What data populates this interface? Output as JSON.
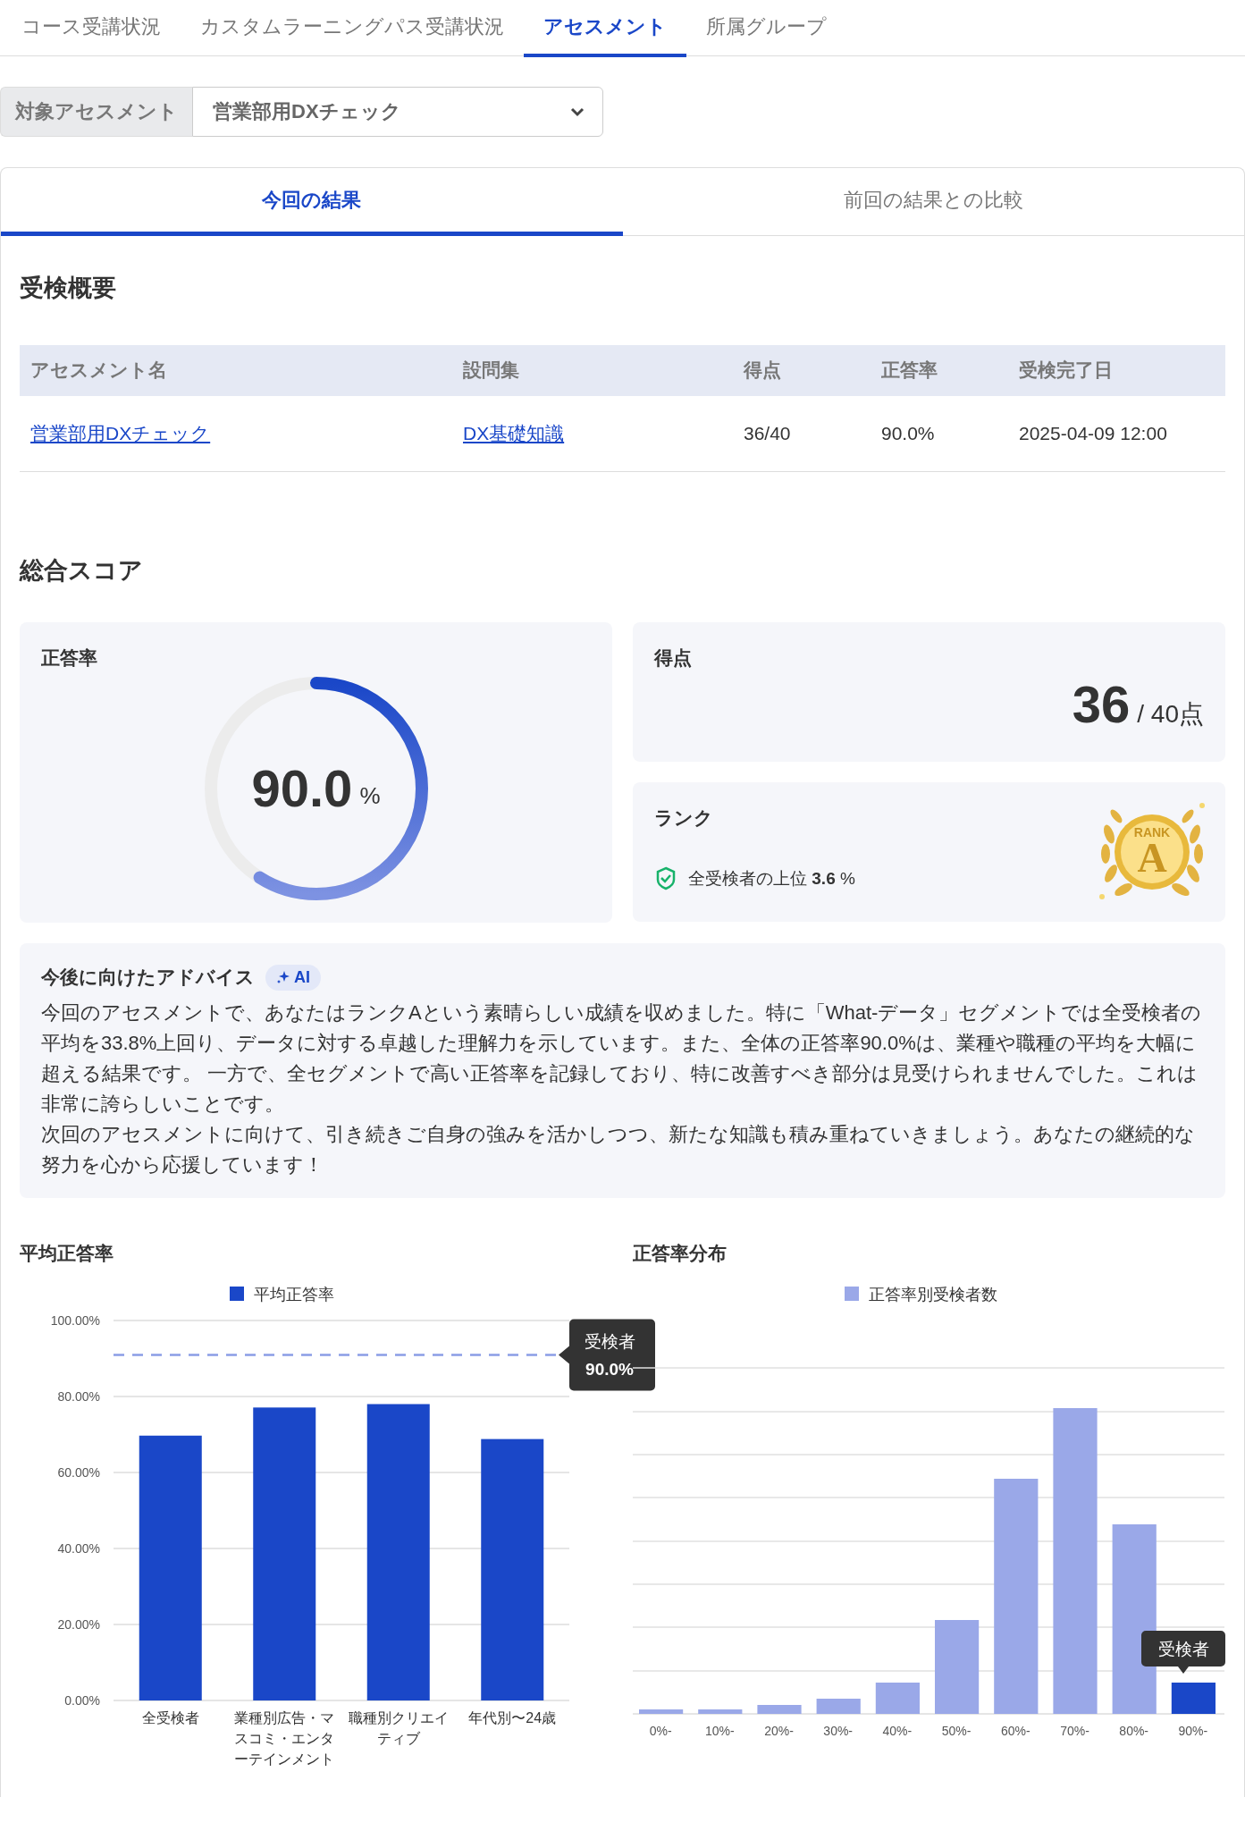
{
  "top_tabs": [
    {
      "label": "コース受講状況",
      "selected": false
    },
    {
      "label": "カスタムラーニングパス受講状況",
      "selected": false
    },
    {
      "label": "アセスメント",
      "selected": true
    },
    {
      "label": "所属グループ",
      "selected": false
    }
  ],
  "assessment_select": {
    "label": "対象アセスメント",
    "value": "営業部用DXチェック"
  },
  "result_tabs": [
    {
      "label": "今回の結果",
      "selected": true
    },
    {
      "label": "前回の結果との比較",
      "selected": false
    }
  ],
  "summary": {
    "title": "受検概要",
    "columns": [
      "アセスメント名",
      "設問集",
      "得点",
      "正答率",
      "受検完了日"
    ],
    "rows": [
      [
        {
          "text": "営業部用DXチェック",
          "kind": "link"
        },
        {
          "text": "DX基礎知識",
          "kind": "link"
        },
        {
          "text": "36/40",
          "kind": "text"
        },
        {
          "text": "90.0%",
          "kind": "text"
        },
        {
          "text": "2025-04-09 12:00",
          "kind": "text"
        }
      ]
    ]
  },
  "total_score": {
    "title": "総合スコア",
    "accuracy": {
      "label": "正答率",
      "value": "90.0",
      "unit": "%",
      "level": 0.59
    },
    "points": {
      "label": "得点",
      "value": "36",
      "max": "/ 40点"
    },
    "rank": {
      "label": "ランク",
      "percentile": "全受検者の上位 **3.6** %",
      "badge_label": "RANK",
      "grade": "A"
    }
  },
  "advice": {
    "title": "今後に向けたアドバイス",
    "badge": "AI",
    "paragraphs": [
      "今回のアセスメントで、あなたはランクAという素晴らしい成績を収めました。特に「What-データ」セグメントでは全受検者の平均を33.8%上回り、データに対する卓越した理解力を示しています。また、全体の正答率90.0%は、業種や職種の平均を大幅に超える結果です。 一方で、全セグメントで高い正答率を記録しており、特に改善すべき部分は見受けられませんでした。これは非常に誇らしいことです。",
      "次回のアセスメントに向けて、引き続きご自身の強みを活かしつつ、新たな知識も積み重ねていきましょう。あなたの継続的な努力を心から応援しています！"
    ]
  },
  "average_chart": {
    "title": "平均正答率",
    "chart_data": {
      "type": "bar",
      "categories": [
        "全受検者",
        "業種別広告・マスコミ・エンターテインメント",
        "職種別クリエイティブ",
        "年代別〜24歳"
      ],
      "series": [
        {
          "name": "平均正答率",
          "color": "#1a47c8",
          "values": [
            69.7,
            77.1,
            78.0,
            68.8
          ]
        }
      ],
      "ylim": [
        0,
        100
      ],
      "grid": true,
      "yticks": [
        {
          "value": 0,
          "label": "0.00%"
        },
        {
          "value": 20,
          "label": "20.00%"
        },
        {
          "value": 40,
          "label": "40.00%"
        },
        {
          "value": 60,
          "label": "60.00%"
        },
        {
          "value": 80,
          "label": "80.00%"
        },
        {
          "value": 100,
          "label": "100.00%"
        }
      ]
    }
  },
  "average_chart_marker": {
    "title": "受検者",
    "value": "90.0%"
  },
  "distribution": {
    "title": "正答率分布",
    "legend": "正答率別受検者数",
    "marker_label": "受検者",
    "bins": [
      {
        "label": "0%-",
        "selected": false
      },
      {
        "label": "10%-",
        "selected": false
      },
      {
        "label": "20%-",
        "selected": false
      },
      {
        "label": "30%-",
        "selected": false
      },
      {
        "label": "40%-",
        "selected": false
      },
      {
        "label": "50%-",
        "selected": false
      },
      {
        "label": "60%-",
        "selected": false
      },
      {
        "label": "70%-",
        "selected": false
      },
      {
        "label": "80%-",
        "selected": false
      },
      {
        "label": "90%-",
        "selected": true
      }
    ]
  }
}
